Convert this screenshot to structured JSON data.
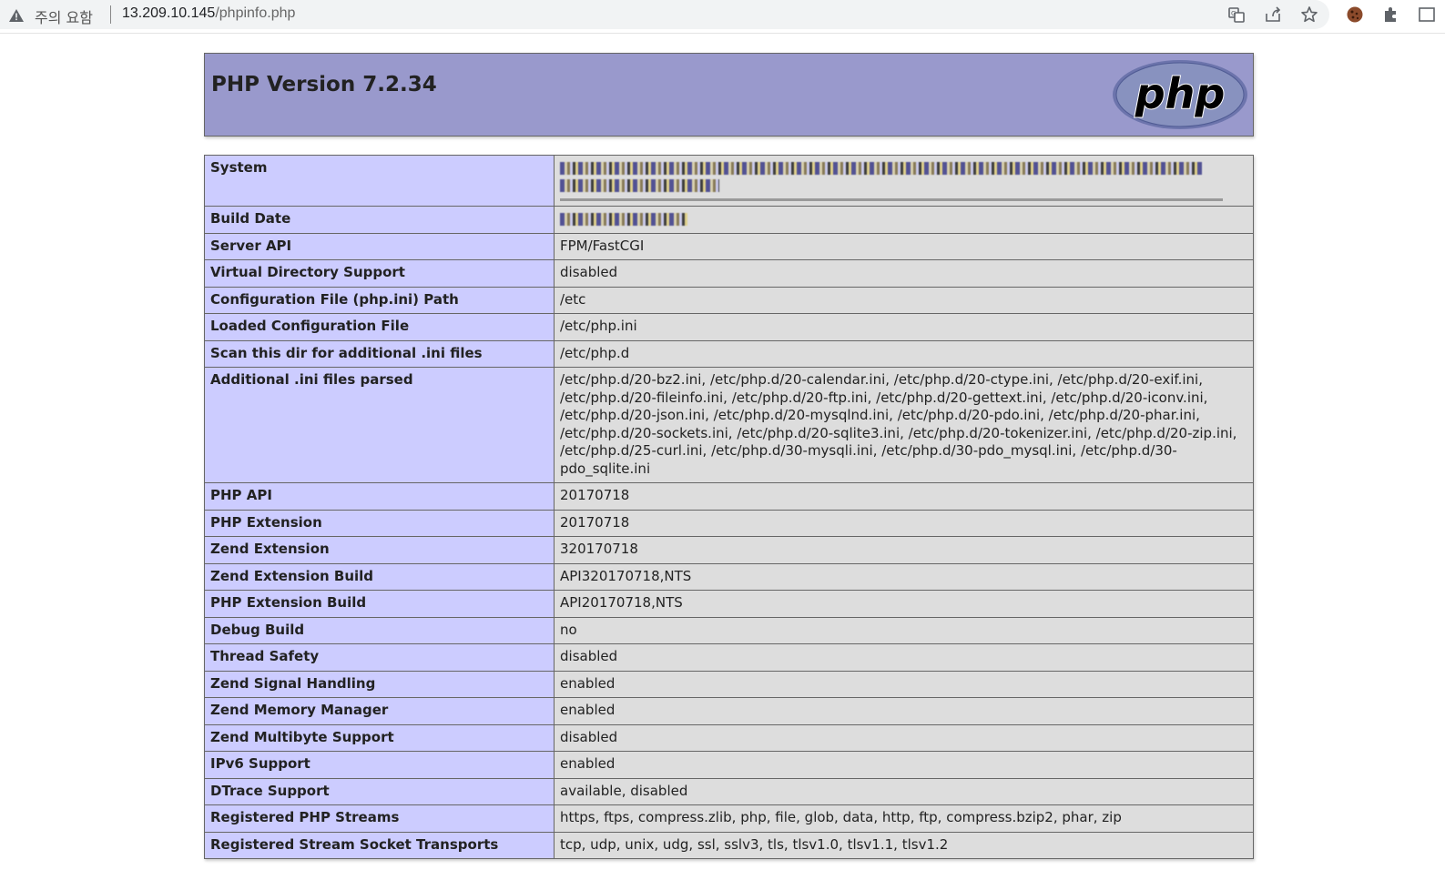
{
  "browser": {
    "security_label": "주의 요함",
    "url_host": "13.209.10.145",
    "url_path": "/phpinfo.php",
    "icons": [
      "warning-icon",
      "translate-icon",
      "share-icon",
      "star-icon",
      "cookie-icon",
      "extensions-icon",
      "sidepanel-icon"
    ]
  },
  "header": {
    "title": "PHP Version 7.2.34",
    "logo_text": "php",
    "colors": {
      "header_bg": "#9999cc",
      "label_bg": "#ccccff",
      "value_bg": "#dddddd"
    }
  },
  "rows": [
    {
      "label": "System",
      "value": ""
    },
    {
      "label": "Build Date",
      "value": ""
    },
    {
      "label": "Server API",
      "value": "FPM/FastCGI"
    },
    {
      "label": "Virtual Directory Support",
      "value": "disabled"
    },
    {
      "label": "Configuration File (php.ini) Path",
      "value": "/etc"
    },
    {
      "label": "Loaded Configuration File",
      "value": "/etc/php.ini"
    },
    {
      "label": "Scan this dir for additional .ini files",
      "value": "/etc/php.d"
    },
    {
      "label": "Additional .ini files parsed",
      "value": "/etc/php.d/20-bz2.ini, /etc/php.d/20-calendar.ini, /etc/php.d/20-ctype.ini, /etc/php.d/20-exif.ini, /etc/php.d/20-fileinfo.ini, /etc/php.d/20-ftp.ini, /etc/php.d/20-gettext.ini, /etc/php.d/20-iconv.ini, /etc/php.d/20-json.ini, /etc/php.d/20-mysqlnd.ini, /etc/php.d/20-pdo.ini, /etc/php.d/20-phar.ini, /etc/php.d/20-sockets.ini, /etc/php.d/20-sqlite3.ini, /etc/php.d/20-tokenizer.ini, /etc/php.d/20-zip.ini, /etc/php.d/25-curl.ini, /etc/php.d/30-mysqli.ini, /etc/php.d/30-pdo_mysql.ini, /etc/php.d/30-pdo_sqlite.ini"
    },
    {
      "label": "PHP API",
      "value": "20170718"
    },
    {
      "label": "PHP Extension",
      "value": "20170718"
    },
    {
      "label": "Zend Extension",
      "value": "320170718"
    },
    {
      "label": "Zend Extension Build",
      "value": "API320170718,NTS"
    },
    {
      "label": "PHP Extension Build",
      "value": "API20170718,NTS"
    },
    {
      "label": "Debug Build",
      "value": "no"
    },
    {
      "label": "Thread Safety",
      "value": "disabled"
    },
    {
      "label": "Zend Signal Handling",
      "value": "enabled"
    },
    {
      "label": "Zend Memory Manager",
      "value": "enabled"
    },
    {
      "label": "Zend Multibyte Support",
      "value": "disabled"
    },
    {
      "label": "IPv6 Support",
      "value": "enabled"
    },
    {
      "label": "DTrace Support",
      "value": "available, disabled"
    },
    {
      "label": "Registered PHP Streams",
      "value": "https, ftps, compress.zlib, php, file, glob, data, http, ftp, compress.bzip2, phar, zip"
    },
    {
      "label": "Registered Stream Socket Transports",
      "value": "tcp, udp, unix, udg, ssl, sslv3, tls, tlsv1.0, tlsv1.1, tlsv1.2"
    }
  ]
}
